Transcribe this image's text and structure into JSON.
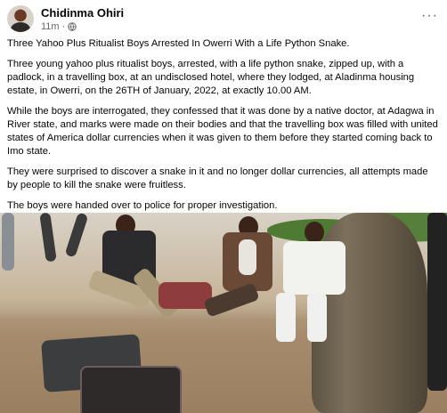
{
  "post": {
    "author": "Chidinma Ohiri",
    "time": "11m",
    "separator": "·",
    "visibility_icon": "globe-icon",
    "more_icon": "more-options-icon",
    "more_label": "···",
    "paragraphs": [
      "Three Yahoo Plus Ritualist Boys Arrested In Owerri With a Life Python Snake.",
      "Three young yahoo plus ritualist boys, arrested, with a life python snake, zipped up, with a padlock, in a travelling box, at an undisclosed hotel, where they lodged, at Aladinma housing estate, in Owerri, on the 26TH of January, 2022, at exactly 10.00 AM.",
      "While the boys are  interrogated, they confessed that it was done by a native doctor, at Adagwa in River state, and marks were made on their bodies and that the travelling box was filled with united states of America dollar currencies when it was given to them before they started coming back to Imo state.",
      "They were surprised to discover a snake in it and no longer dollar currencies, all attempts made by people to kill the snake were fruitless.",
      "The boys were handed over to police for proper investigation."
    ]
  },
  "colors": {
    "text": "#050505",
    "secondary_text": "#65676b",
    "background": "#ffffff"
  }
}
